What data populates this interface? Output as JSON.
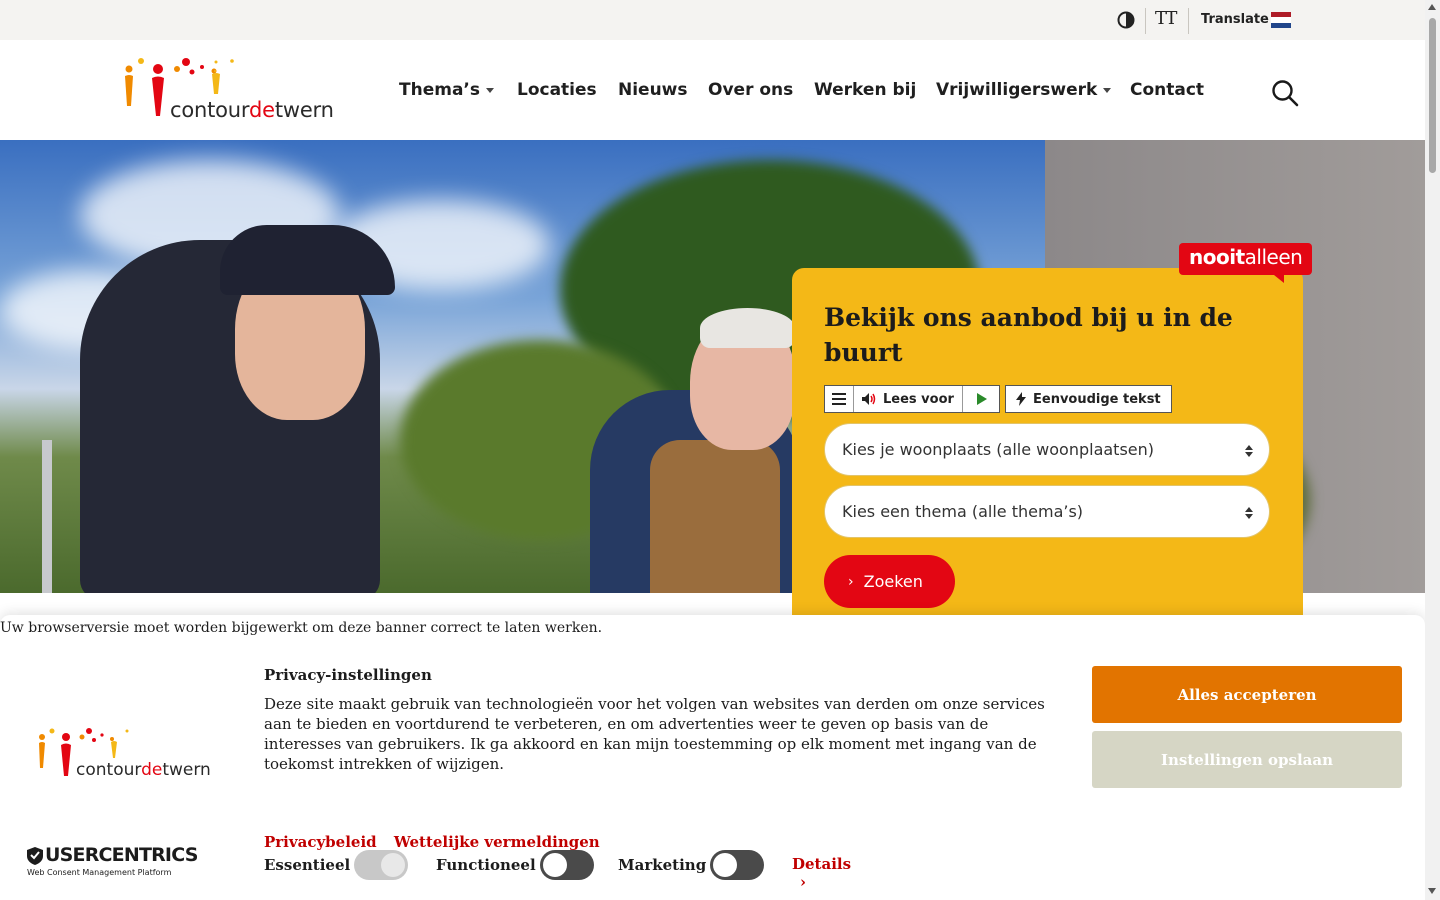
{
  "utility": {
    "translate_label": "Translate",
    "text_size_label": "TT",
    "colors": {
      "flag_red": "#ae1c28",
      "flag_white": "#ffffff",
      "flag_blue": "#21468b"
    }
  },
  "brand": {
    "logo_part1": "contour",
    "logo_part2": "de",
    "logo_part3": "twern",
    "colors": {
      "red": "#e30613",
      "orange": "#f08a00",
      "yellow": "#f4b817"
    }
  },
  "nav": {
    "items": [
      {
        "label": "Thema’s",
        "has_dropdown": true
      },
      {
        "label": "Locaties",
        "has_dropdown": false
      },
      {
        "label": "Nieuws",
        "has_dropdown": false
      },
      {
        "label": "Over ons",
        "has_dropdown": false
      },
      {
        "label": "Werken bij",
        "has_dropdown": false
      },
      {
        "label": "Vrijwilligerswerk",
        "has_dropdown": true
      },
      {
        "label": "Contact",
        "has_dropdown": false
      }
    ],
    "search_icon": "search-icon"
  },
  "hero": {
    "badge_part1": "nooit",
    "badge_part2": "alleen",
    "card_title": "Bekijk ons aanbod bij u in de buurt",
    "readspeaker": {
      "listen_label": "Lees voor"
    },
    "simple_text_label": "Eenvoudige tekst",
    "select_place": "Kies je woonplaats (alle woonplaatsen)",
    "select_theme": "Kies een thema (alle thema’s)",
    "search_button": "Zoeken"
  },
  "banner": {
    "outdated_notice": "Uw browserversie moet worden bijgewerkt om deze banner correct te laten werken.",
    "title": "Privacy-instellingen",
    "body": "Deze site maakt gebruik van technologieën voor het volgen van websites van derden om onze services aan te bieden en voortdurend te verbeteren, en om advertenties weer te geven op basis van de interesses van gebruikers. Ik ga akkoord en kan mijn toestemming op elk moment met ingang van de toekomst intrekken of wijzigen.",
    "link_privacy": "Privacybeleid",
    "link_legal": "Wettelijke vermeldingen",
    "toggles": [
      {
        "label": "Essentieel",
        "state": "on-disabled"
      },
      {
        "label": "Functioneel",
        "state": "off"
      },
      {
        "label": "Marketing",
        "state": "off"
      }
    ],
    "details_label": "Details",
    "accept_all": "Alles accepteren",
    "save_settings": "Instellingen opslaan",
    "uc_name": "USERCENTRICS",
    "uc_sub": "Web Consent Management Platform",
    "colors": {
      "accept": "#e27400",
      "save": "#d6d6c5",
      "link": "#c00000"
    }
  }
}
